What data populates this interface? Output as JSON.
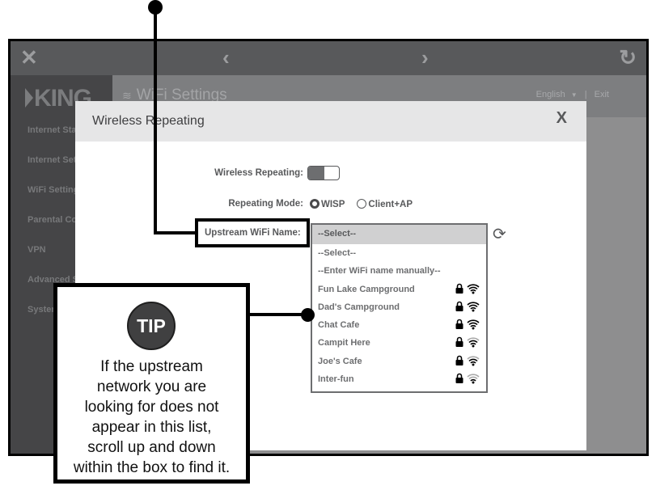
{
  "browser_toolbar": {
    "close_icon": "close-icon",
    "close_glyph": "✕",
    "back_glyph": "‹",
    "forward_glyph": "›",
    "reload_glyph": "↻"
  },
  "brand": {
    "logo_text": "KING"
  },
  "sidebar": {
    "items": [
      {
        "label": "Internet Status"
      },
      {
        "label": "Internet Settings"
      },
      {
        "label": "WiFi Settings"
      },
      {
        "label": "Parental Controls"
      },
      {
        "label": "VPN"
      },
      {
        "label": "Advanced Settings"
      },
      {
        "label": "System"
      }
    ]
  },
  "header": {
    "page_title": "WiFi Settings",
    "wifi_glyph": "≋",
    "language": "English",
    "language_arrow": "▼",
    "separator": "|",
    "exit_label": "Exit"
  },
  "modal": {
    "title": "Wireless Repeating",
    "close_label": "X",
    "wireless_repeating_label": "Wireless Repeating:",
    "wireless_repeating_enabled": true,
    "repeating_mode_label": "Repeating Mode:",
    "modes": [
      {
        "label": "WISP",
        "selected": true
      },
      {
        "label": "Client+AP",
        "selected": false
      }
    ],
    "upstream_label": "Upstream WiFi Name:",
    "upstream_selected": "--Select--",
    "refresh_glyph": "⟳",
    "options": [
      {
        "label": "--Select--",
        "secured": false,
        "signal": null
      },
      {
        "label": "--Enter WiFi name manually--",
        "secured": false,
        "signal": null
      },
      {
        "label": "Fun Lake Campground",
        "secured": true,
        "signal": 4
      },
      {
        "label": "Dad's Campground",
        "secured": true,
        "signal": 4
      },
      {
        "label": "Chat Cafe",
        "secured": true,
        "signal": 4
      },
      {
        "label": "Campit Here",
        "secured": true,
        "signal": 3
      },
      {
        "label": "Joe's Cafe",
        "secured": true,
        "signal": 3
      },
      {
        "label": "Inter-fun",
        "secured": true,
        "signal": 2
      }
    ]
  },
  "tip": {
    "badge": "TIP",
    "lines": [
      "If the upstream",
      "network you are",
      "looking for does not",
      "appear in this list,",
      "scroll up and down",
      "within the box to find it."
    ]
  },
  "colors": {
    "dark_text": "#58595b",
    "toolbar_bg": "#58595b",
    "sidebar_bg": "#454547",
    "overlay_bg": "#8e8e8f",
    "selected_row_bg": "#d0d0d1"
  }
}
